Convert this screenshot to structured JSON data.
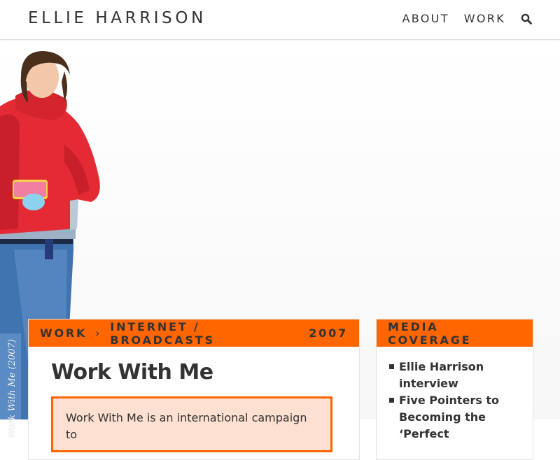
{
  "header": {
    "site_title": "ELLIE HARRISON",
    "nav": {
      "about": "ABOUT",
      "work": "WORK",
      "search_icon": "search-icon"
    }
  },
  "hero": {
    "caption": "Work With Me (2007)"
  },
  "main": {
    "breadcrumb": {
      "work": "WORK",
      "category": "INTERNET / BROADCASTS",
      "separator": "›",
      "year": "2007"
    },
    "title": "Work With Me",
    "intro": "Work With Me is an international campaign to"
  },
  "sidebar": {
    "heading": "MEDIA COVERAGE",
    "items": [
      {
        "label": "Ellie Harrison interview"
      },
      {
        "label": "Five Pointers to Becoming the ‘Perfect"
      }
    ]
  },
  "colors": {
    "accent": "#ff6600",
    "intro_bg": "#fde0d0",
    "text": "#333333"
  }
}
